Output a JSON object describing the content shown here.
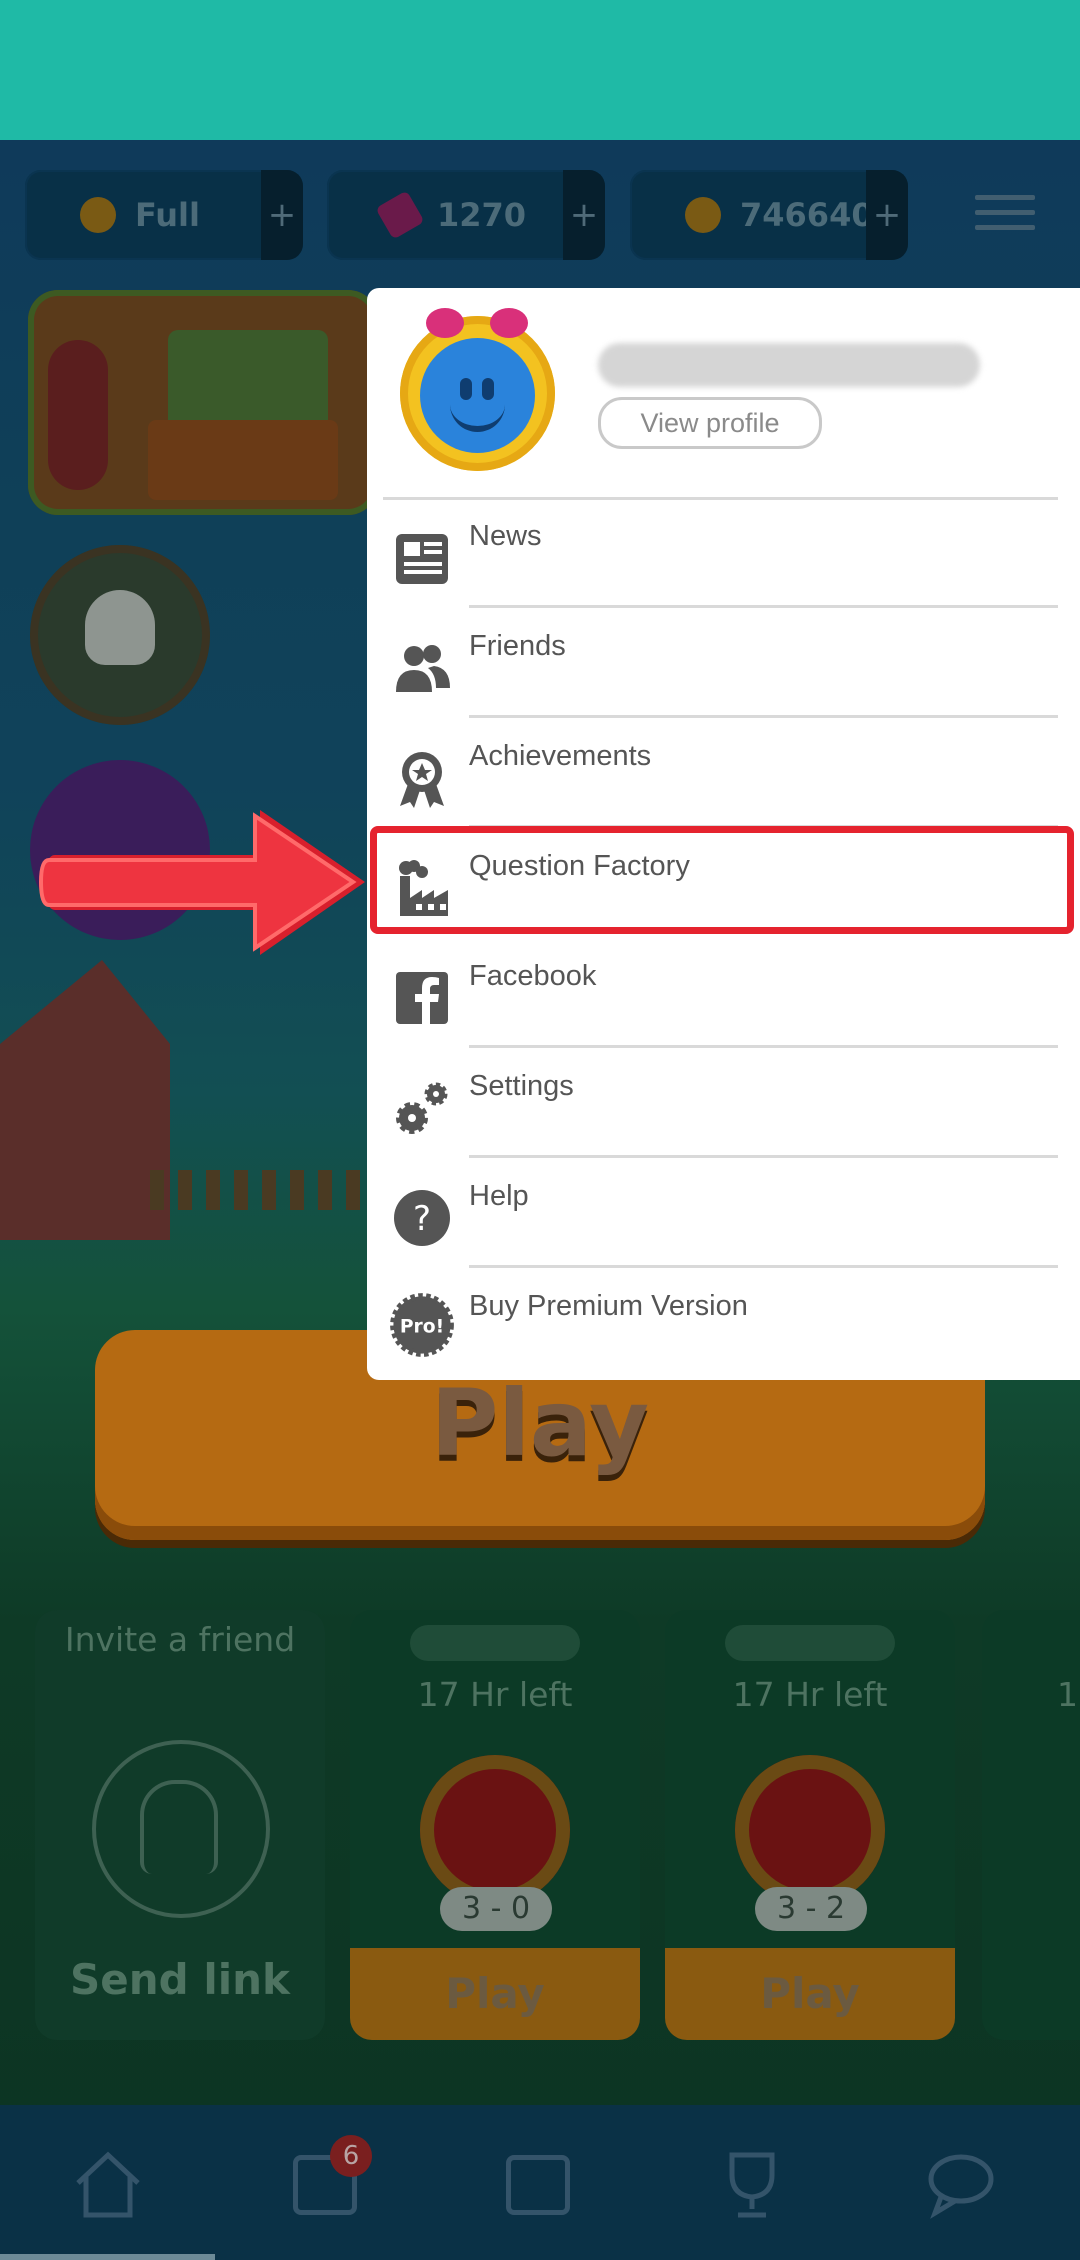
{
  "topbar": {
    "lives": {
      "value": "Full",
      "plus": "+",
      "icon": "heart-infinity-icon"
    },
    "tickets": {
      "value": "1270",
      "plus": "+",
      "icon": "ticket-icon"
    },
    "coins": {
      "value": "746640",
      "plus": "+",
      "icon": "coin-icon"
    },
    "menu_icon": "hamburger-menu-icon"
  },
  "main": {
    "play_button_label": "Play",
    "invite_card": {
      "title": "Invite a friend",
      "action": "Send link"
    },
    "games": [
      {
        "time_left": "17 Hr left",
        "score": "3 - 0",
        "action": "Play"
      },
      {
        "time_left": "17 Hr left",
        "score": "3 - 2",
        "action": "Play"
      },
      {
        "time_left": "1"
      }
    ]
  },
  "bottom_nav": {
    "items": [
      "home-icon",
      "calendar-icon",
      "shop-icon",
      "trophy-icon",
      "chat-icon"
    ],
    "calendar_badge": "6"
  },
  "side_menu": {
    "profile": {
      "view_profile_label": "View profile"
    },
    "items": [
      {
        "label": "News",
        "icon": "newspaper-icon"
      },
      {
        "label": "Friends",
        "icon": "friends-icon"
      },
      {
        "label": "Achievements",
        "icon": "medal-icon"
      },
      {
        "label": "Question Factory",
        "icon": "factory-icon"
      },
      {
        "label": "Facebook",
        "icon": "facebook-icon"
      },
      {
        "label": "Settings",
        "icon": "gears-icon"
      },
      {
        "label": "Help",
        "icon": "question-icon"
      },
      {
        "label": "Buy Premium Version",
        "icon": "pro-badge-icon",
        "icon_text": "Pro!"
      }
    ]
  },
  "colors": {
    "teal_bar": "#1fbaa6",
    "highlight_red": "#e5232e",
    "menu_text": "#555555"
  }
}
